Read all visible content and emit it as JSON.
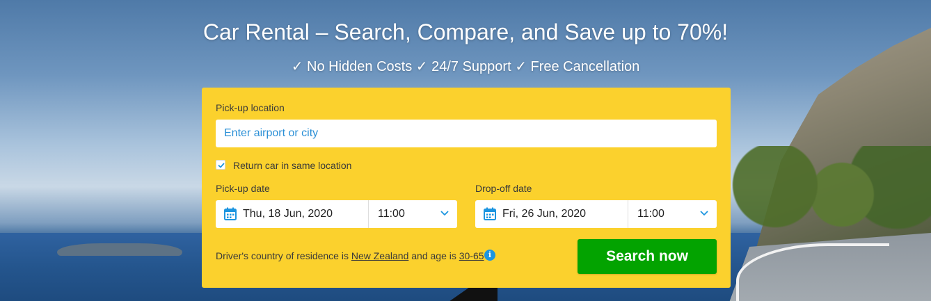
{
  "hero": {
    "headline": "Car Rental – Search, Compare, and Save up to 70%!",
    "subline": "✓ No Hidden Costs ✓ 24/7 Support ✓ Free Cancellation"
  },
  "search_form": {
    "pickup_location_label": "Pick-up location",
    "pickup_location_placeholder": "Enter airport or city",
    "pickup_location_value": "",
    "return_same_location_label": "Return car in same location",
    "return_same_location_checked": true,
    "pickup_date_label": "Pick-up date",
    "pickup_date_value": "Thu, 18 Jun, 2020",
    "pickup_time_value": "11:00",
    "dropoff_date_label": "Drop-off date",
    "dropoff_date_value": "Fri, 26 Jun, 2020",
    "dropoff_time_value": "11:00",
    "residence_prefix": "Driver's country of residence is",
    "residence_country": "New Zealand",
    "age_prefix": "and age is",
    "age_range": "30-65",
    "info_icon": "i",
    "search_button_label": "Search now"
  },
  "colors": {
    "panel_bg": "#fbd12d",
    "search_button_bg": "#03a300",
    "accent_blue": "#1d95e0"
  },
  "icons": [
    "calendar-icon",
    "chevron-down-icon",
    "checkmark-icon",
    "info-icon"
  ]
}
